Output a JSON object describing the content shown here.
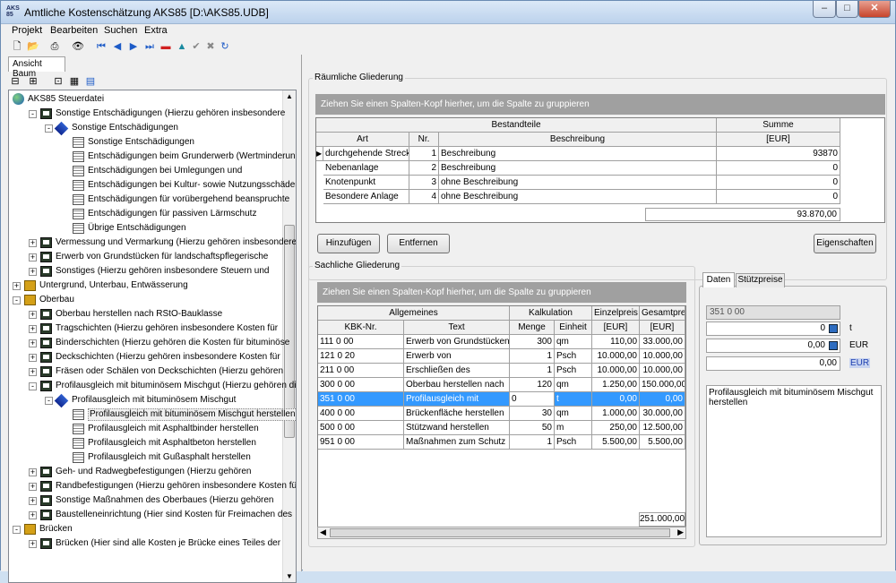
{
  "window": {
    "title": "Amtliche Kostenschätzung AKS85 [D:\\AKS85.UDB]",
    "app_icon_text": "AKS 85"
  },
  "menu": [
    "Projekt",
    "Bearbeiten",
    "Suchen",
    "Extra"
  ],
  "left_tab": "Ansicht Baum",
  "tree": [
    {
      "level": 0,
      "icon": "globe",
      "label": "AKS85 Steuerdatei",
      "exp": ""
    },
    {
      "level": 1,
      "icon": "folder",
      "label": "Sonstige Entschädigungen (Hierzu gehören insbesondere",
      "exp": "-"
    },
    {
      "level": 2,
      "icon": "diamond",
      "label": "Sonstige Entschädigungen",
      "exp": "-"
    },
    {
      "level": 3,
      "icon": "grid",
      "label": "Sonstige Entschädigungen",
      "exp": ""
    },
    {
      "level": 3,
      "icon": "grid",
      "label": "Entschädigungen beim Grunderwerb (Wertminderung,",
      "exp": ""
    },
    {
      "level": 3,
      "icon": "grid",
      "label": "Entschädigungen bei Umlegungen und",
      "exp": ""
    },
    {
      "level": 3,
      "icon": "grid",
      "label": "Entschädigungen bei Kultur- sowie Nutzungsschäden",
      "exp": ""
    },
    {
      "level": 3,
      "icon": "grid",
      "label": "Entschädigungen für vorübergehend beanspruchte",
      "exp": ""
    },
    {
      "level": 3,
      "icon": "grid",
      "label": "Entschädigungen für passiven Lärmschutz",
      "exp": ""
    },
    {
      "level": 3,
      "icon": "grid",
      "label": "Übrige Entschädigungen",
      "exp": ""
    },
    {
      "level": 1,
      "icon": "folder",
      "label": "Vermessung und Vermarkung (Hierzu gehören insbesondere",
      "exp": "+"
    },
    {
      "level": 1,
      "icon": "folder",
      "label": "Erwerb von Grundstücken für landschaftspflegerische",
      "exp": "+"
    },
    {
      "level": 1,
      "icon": "folder",
      "label": "Sonstiges (Hierzu gehören insbesondere Steuern und",
      "exp": "+"
    },
    {
      "level": 0,
      "icon": "bank",
      "label": "Untergrund, Unterbau, Entwässerung",
      "exp": "+"
    },
    {
      "level": 0,
      "icon": "bank",
      "label": "Oberbau",
      "exp": "-"
    },
    {
      "level": 1,
      "icon": "folder",
      "label": "Oberbau herstellen nach RStO-Bauklasse",
      "exp": "+"
    },
    {
      "level": 1,
      "icon": "folder",
      "label": "Tragschichten (Hierzu gehören insbesondere Kosten für",
      "exp": "+"
    },
    {
      "level": 1,
      "icon": "folder",
      "label": "Binderschichten (Hierzu gehören die Kosten für bituminöse",
      "exp": "+"
    },
    {
      "level": 1,
      "icon": "folder",
      "label": "Deckschichten (Hierzu gehören insbesondere Kosten für",
      "exp": "+"
    },
    {
      "level": 1,
      "icon": "folder",
      "label": "Fräsen oder Schälen von Deckschichten (Hierzu gehören",
      "exp": "+"
    },
    {
      "level": 1,
      "icon": "folder",
      "label": "Profilausgleich mit bituminösem Mischgut (Hierzu gehören die",
      "exp": "-"
    },
    {
      "level": 2,
      "icon": "diamond",
      "label": "Profilausgleich mit bituminösem Mischgut",
      "exp": "-"
    },
    {
      "level": 3,
      "icon": "grid",
      "label": "Profilausgleich mit bituminösem Mischgut herstellen",
      "exp": "",
      "sel": true
    },
    {
      "level": 3,
      "icon": "grid",
      "label": "Profilausgleich mit Asphaltbinder herstellen",
      "exp": ""
    },
    {
      "level": 3,
      "icon": "grid",
      "label": "Profilausgleich mit Asphaltbeton herstellen",
      "exp": ""
    },
    {
      "level": 3,
      "icon": "grid",
      "label": "Profilausgleich mit Gußasphalt herstellen",
      "exp": ""
    },
    {
      "level": 1,
      "icon": "folder",
      "label": "Geh- und Radwegbefestigungen (Hierzu gehören",
      "exp": "+"
    },
    {
      "level": 1,
      "icon": "folder",
      "label": "Randbefestigungen (Hierzu gehören insbesondere Kosten für",
      "exp": "+"
    },
    {
      "level": 1,
      "icon": "folder",
      "label": "Sonstige Maßnahmen des Oberbaues (Hierzu gehören",
      "exp": "+"
    },
    {
      "level": 1,
      "icon": "folder",
      "label": "Baustelleneinrichtung (Hier sind Kosten für Freimachen des",
      "exp": "+"
    },
    {
      "level": 0,
      "icon": "bank",
      "label": "Brücken",
      "exp": "-"
    },
    {
      "level": 1,
      "icon": "folder",
      "label": "Brücken (Hier sind alle Kosten je Brücke eines Teiles der",
      "exp": "+"
    }
  ],
  "raeumlich": {
    "title": "Räumliche Gliederung",
    "group_hint": "Ziehen Sie einen Spalten-Kopf hierher, um die Spalte zu gruppieren",
    "band_bestandteile": "Bestandteile",
    "band_summe": "Summe",
    "col_art": "Art",
    "col_nr": "Nr.",
    "col_beschreibung": "Beschreibung",
    "col_eur": "[EUR]",
    "rows": [
      {
        "art": "durchgehende Strecke",
        "nr": "1",
        "beschreibung": "Beschreibung",
        "summe": "93870"
      },
      {
        "art": "Nebenanlage",
        "nr": "2",
        "beschreibung": "Beschreibung",
        "summe": "0"
      },
      {
        "art": "Knotenpunkt",
        "nr": "3",
        "beschreibung": "ohne Beschreibung",
        "summe": "0"
      },
      {
        "art": "Besondere Anlage",
        "nr": "4",
        "beschreibung": "ohne Beschreibung",
        "summe": "0"
      }
    ],
    "total": "93.870,00",
    "btn_add": "Hinzufügen",
    "btn_remove": "Entfernen",
    "btn_props": "Eigenschaften"
  },
  "sachlich": {
    "title": "Sachliche Gliederung",
    "group_hint": "Ziehen Sie einen Spalten-Kopf hierher, um die Spalte zu gruppieren",
    "band_allgemeines": "Allgemeines",
    "band_kalkulation": "Kalkulation",
    "band_einzelpreis": "Einzelpreis",
    "band_gesamtpreis": "Gesamtpreis",
    "col_kbk": "KBK-Nr.",
    "col_text": "Text",
    "col_menge": "Menge",
    "col_einheit": "Einheit",
    "col_eur1": "[EUR]",
    "col_eur2": "[EUR]",
    "rows": [
      {
        "kbk": "111 0 00",
        "text": "Erwerb von Grundstücken",
        "menge": "300",
        "einheit": "qm",
        "ep": "110,00",
        "gp": "33.000,00"
      },
      {
        "kbk": "121 0 20",
        "text": "Erwerb von",
        "menge": "1",
        "einheit": "Psch",
        "ep": "10.000,00",
        "gp": "10.000,00"
      },
      {
        "kbk": "211 0 00",
        "text": "Erschließen des",
        "menge": "1",
        "einheit": "Psch",
        "ep": "10.000,00",
        "gp": "10.000,00"
      },
      {
        "kbk": "300 0 00",
        "text": "Oberbau herstellen nach",
        "menge": "120",
        "einheit": "qm",
        "ep": "1.250,00",
        "gp": "150.000,00"
      },
      {
        "kbk": "351 0 00",
        "text": "Profilausgleich mit",
        "menge": "0",
        "einheit": "t",
        "ep": "0,00",
        "gp": "0,00",
        "sel": true
      },
      {
        "kbk": "400 0 00",
        "text": "Brückenfläche herstellen",
        "menge": "30",
        "einheit": "qm",
        "ep": "1.000,00",
        "gp": "30.000,00"
      },
      {
        "kbk": "500 0 00",
        "text": "Stützwand herstellen",
        "menge": "50",
        "einheit": "m",
        "ep": "250,00",
        "gp": "12.500,00"
      },
      {
        "kbk": "951 0 00",
        "text": "Maßnahmen zum Schutz",
        "menge": "1",
        "einheit": "Psch",
        "ep": "5.500,00",
        "gp": "5.500,00"
      }
    ],
    "total": "251.000,00"
  },
  "details": {
    "tab_daten": "Daten",
    "tab_stuetzpreise": "Stützpreise",
    "kbk": "351 0 00",
    "menge": "0",
    "unit_menge": "t",
    "einzelpreis": "0,00",
    "unit_ep": "EUR",
    "gesamtpreis": "0,00",
    "unit_gp": "EUR",
    "text": "Profilausgleich mit bituminösem Mischgut herstellen"
  }
}
